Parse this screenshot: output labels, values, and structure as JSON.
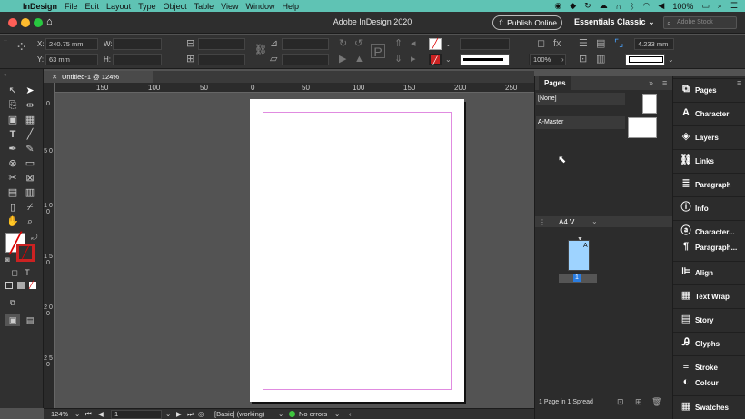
{
  "menubar": {
    "app": "InDesign",
    "items": [
      "File",
      "Edit",
      "Layout",
      "Type",
      "Object",
      "Table",
      "View",
      "Window",
      "Help"
    ],
    "battery": "100%"
  },
  "titlebar": {
    "title": "Adobe InDesign 2020",
    "publish": "Publish Online",
    "workspace": "Essentials Classic",
    "stock_placeholder": "Adobe Stock"
  },
  "control": {
    "x_label": "X:",
    "x_value": "240.75 mm",
    "y_label": "Y:",
    "y_value": "63 mm",
    "w_label": "W:",
    "h_label": "H:",
    "stroke_weight": "4.233 mm",
    "opacity": "100%"
  },
  "document": {
    "tab": "Untitled-1 @ 124%"
  },
  "ruler": {
    "h_labels": [
      "100",
      "150",
      "100",
      "50",
      "0",
      "50",
      "100",
      "150",
      "200",
      "250"
    ],
    "v_labels": [
      "0",
      "5 0",
      "1 0 0",
      "1 5 0",
      "2 0 0",
      "2 5 0"
    ]
  },
  "status": {
    "zoom": "124%",
    "page": "1",
    "style": "[Basic] (working)",
    "errors": "No errors"
  },
  "pages_panel": {
    "title": "Pages",
    "none_master": "[None]",
    "a_master": "A-Master",
    "page_size": "A4 V",
    "page_badge": "A",
    "page_number": "1",
    "footer": "1 Page in 1 Spread"
  },
  "dock": [
    "Pages",
    "Character",
    "Layers",
    "Links",
    "Paragraph",
    "Info",
    "Character...",
    "Paragraph...",
    "Align",
    "Text Wrap",
    "Story",
    "Glyphs",
    "Stroke",
    "Colour",
    "Swatches"
  ]
}
